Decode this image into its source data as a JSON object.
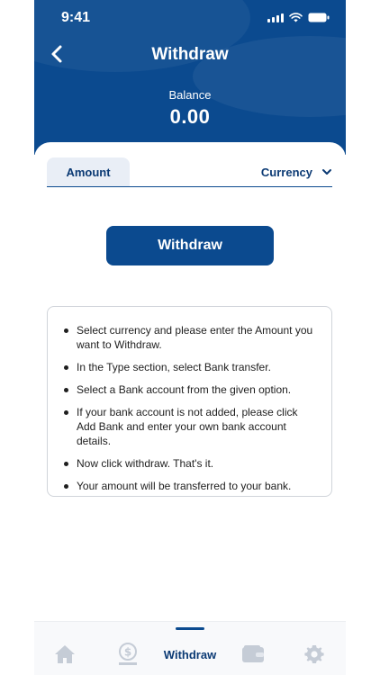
{
  "status_bar": {
    "time": "9:41"
  },
  "header": {
    "title": "Withdraw",
    "balance_label": "Balance",
    "balance_value": "0.00"
  },
  "tabs": {
    "amount_label": "Amount",
    "currency_label": "Currency"
  },
  "action": {
    "withdraw_label": "Withdraw"
  },
  "instructions": [
    "Select currency and please enter the Amount you want to Withdraw.",
    "In the Type section, select Bank transfer.",
    "Select a Bank account from the given option.",
    "If your bank account is not added, please click Add Bank and enter your own bank account details.",
    "Now click withdraw. That's it.",
    "Your amount will be transferred to your bank."
  ],
  "bottom_nav": {
    "active_label": "Withdraw",
    "items": [
      "home-icon",
      "money-icon",
      "withdraw",
      "wallet-icon",
      "settings-icon"
    ]
  },
  "colors": {
    "primary": "#0b4a8f",
    "tab_bg": "#e9eef6",
    "nav_icon": "#c5ccd6"
  }
}
